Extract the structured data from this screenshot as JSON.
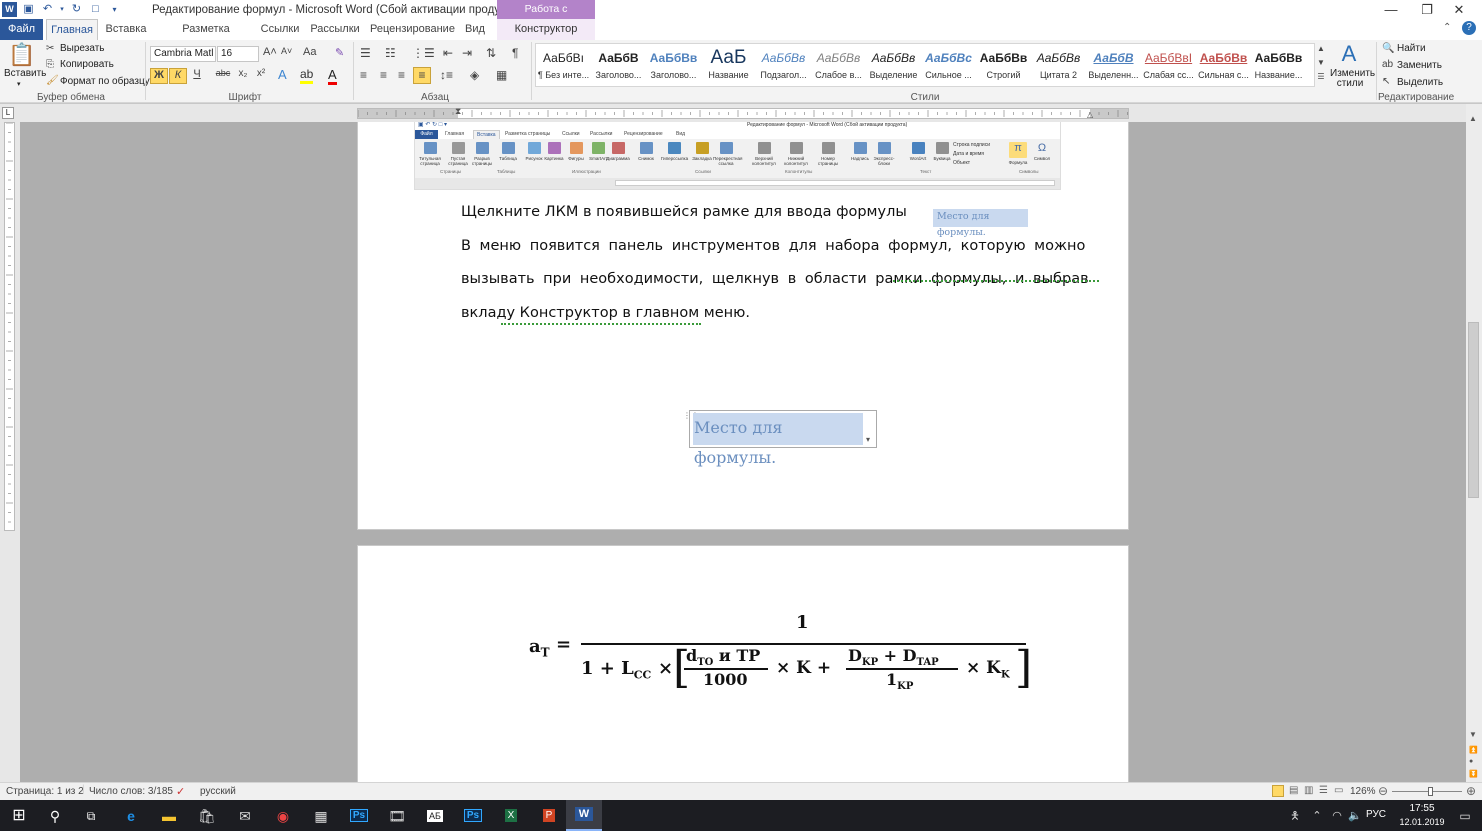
{
  "window": {
    "title": "Редактирование формул  -  Microsoft Word (Сбой активации продукта)",
    "context_group": "Работа с формулами",
    "controls": {
      "minimize": "—",
      "restore": "❐",
      "close": "✕"
    }
  },
  "tabs": [
    "Файл",
    "Главная",
    "Вставка",
    "Разметка страницы",
    "Ссылки",
    "Рассылки",
    "Рецензирование",
    "Вид",
    "Конструктор"
  ],
  "clipboard": {
    "paste": "Вставить",
    "cut": "Вырезать",
    "copy": "Копировать",
    "format_painter": "Формат по образцу",
    "label": "Буфер обмена"
  },
  "font": {
    "name": "Cambria Matl",
    "size": "16",
    "label": "Шрифт",
    "bold": "Ж",
    "italic": "К",
    "underline": "Ч",
    "strike": "abc",
    "sub": "x₂",
    "sup": "x²"
  },
  "paragraph": {
    "label": "Абзац"
  },
  "styles": {
    "label": "Стили",
    "change_styles": "Изменить стили",
    "items": [
      {
        "preview": "АаБбВı",
        "name": "¶ Без инте..."
      },
      {
        "preview": "АаБбВ",
        "name": "Заголово..."
      },
      {
        "preview": "АаБбВв",
        "name": "Заголово..."
      },
      {
        "preview": "АаБ",
        "name": "Название"
      },
      {
        "preview": "АаБбВв",
        "name": "Подзагол..."
      },
      {
        "preview": "АаБбВв",
        "name": "Слабое в..."
      },
      {
        "preview": "АаБбВв",
        "name": "Выделение"
      },
      {
        "preview": "АаБбВс",
        "name": "Сильное ..."
      },
      {
        "preview": "АаБбВв",
        "name": "Строгий"
      },
      {
        "preview": "АаБбВв",
        "name": "Цитата 2"
      },
      {
        "preview": "АаБбВ",
        "name": "Выделенн..."
      },
      {
        "preview": "АаБбВвI",
        "name": "Слабая сс..."
      },
      {
        "preview": "АаБбВв",
        "name": "Сильная с..."
      },
      {
        "preview": "АаБбВв",
        "name": "Название..."
      }
    ]
  },
  "editing": {
    "find": "Найти",
    "replace": "Заменить",
    "select": "Выделить",
    "label": "Редактирование"
  },
  "inset": {
    "title": "Редактирование формул - Microsoft Word (Сбой активации продукта)",
    "tabs": [
      "Файл",
      "Главная",
      "Вставка",
      "Разметка страницы",
      "Ссылки",
      "Рассылки",
      "Рецензирование",
      "Вид"
    ],
    "groups": [
      "Страницы",
      "Таблицы",
      "Иллюстрации",
      "Ссылки",
      "Колонтитулы",
      "Текст",
      "Символы"
    ],
    "buttons": [
      "Титульная страница",
      "Пустая страница",
      "Разрыв страницы",
      "Таблица",
      "Рисунок",
      "Картинка",
      "Фигуры",
      "SmartArt",
      "Диаграмма",
      "Снимок",
      "Гиперссылка",
      "Закладка",
      "Перекрестная ссылка",
      "Верхний колонтитул",
      "Нижний колонтитул",
      "Номер страницы",
      "Надпись",
      "Экспресс-блоки",
      "WordArt",
      "Буквица",
      "Строка подписи",
      "Дата и время",
      "Объект",
      "Формула",
      "Символ"
    ]
  },
  "document": {
    "line1": "Щелкните ЛКМ в появившейся рамке для ввода формулы",
    "small_placeholder": "Место для формулы.",
    "para_line1": "В меню появится панель инструментов для набора формул, которую  можно",
    "para_line2": "вызывать при необходимости, щелкнув в области рамки формулы, и выбрав",
    "para_line3": "вкладу Конструктор в главном меню.",
    "equation_placeholder": "Место для формулы."
  },
  "formula": {
    "lhs": "a",
    "lhs_sub": "T",
    "eq": "=",
    "num": "1",
    "d1": "1 + L",
    "d1_sub": "CC",
    "times": "×",
    "in_num": "d",
    "in_num_sub": "TO",
    "in_num_rest": " и TP",
    "in_den": "1000",
    "k": "× K +",
    "f2_num": "D",
    "f2_num_sub1": "KP",
    "f2_plus": " + D",
    "f2_num_sub2": "TAP",
    "f2_den": "1",
    "f2_den_sub": "KP",
    "k2": "× K",
    "k2_sub": "K"
  },
  "status": {
    "page": "Страница: 1 из 2",
    "words": "Число слов: 3/185",
    "lang": "русский",
    "zoom": "126%"
  },
  "taskbar": {
    "lang": "РУС",
    "time": "17:55",
    "date": "12.01.2019"
  }
}
